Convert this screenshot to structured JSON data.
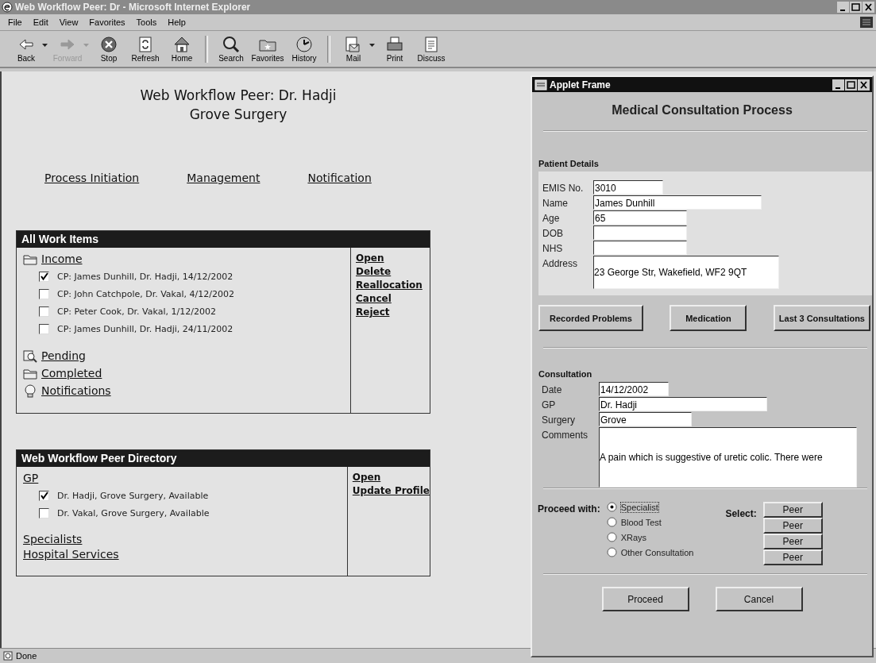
{
  "browser": {
    "title": "Web Workflow Peer: Dr - Microsoft Internet Explorer",
    "menu": [
      "File",
      "Edit",
      "View",
      "Favorites",
      "Tools",
      "Help"
    ],
    "toolbar": [
      {
        "label": "Back",
        "kind": "back",
        "disabled": false,
        "dropdown": true
      },
      {
        "label": "Forward",
        "kind": "forward",
        "disabled": true,
        "dropdown": true
      },
      {
        "label": "Stop",
        "kind": "stop",
        "disabled": false,
        "dropdown": false
      },
      {
        "label": "Refresh",
        "kind": "refresh",
        "disabled": false,
        "dropdown": false
      },
      {
        "label": "Home",
        "kind": "home",
        "disabled": false,
        "dropdown": false
      },
      {
        "label": "Search",
        "kind": "search",
        "disabled": false,
        "dropdown": false
      },
      {
        "label": "Favorites",
        "kind": "favorites",
        "disabled": false,
        "dropdown": false
      },
      {
        "label": "History",
        "kind": "history",
        "disabled": false,
        "dropdown": false
      },
      {
        "label": "Mail",
        "kind": "mail",
        "disabled": false,
        "dropdown": true
      },
      {
        "label": "Print",
        "kind": "print",
        "disabled": false,
        "dropdown": false
      },
      {
        "label": "Discuss",
        "kind": "discuss",
        "disabled": false,
        "dropdown": false
      }
    ],
    "status": "Done"
  },
  "page": {
    "heading": [
      "Web Workflow Peer: Dr. Hadji",
      "Grove Surgery"
    ],
    "nav": [
      "Process Initiation",
      "Management",
      "Notification"
    ],
    "work_items": {
      "title": "All Work Items",
      "folders": [
        {
          "label": "Income",
          "kind": "folder",
          "items": [
            {
              "text": "CP: James Dunhill, Dr. Hadji, 14/12/2002",
              "checked": true
            },
            {
              "text": "CP: John Catchpole, Dr. Vakal, 4/12/2002",
              "checked": false
            },
            {
              "text": "CP: Peter Cook, Dr. Vakal, 1/12/2002",
              "checked": false
            },
            {
              "text": "CP: James Dunhill, Dr. Hadji, 24/11/2002",
              "checked": false
            }
          ]
        },
        {
          "label": "Pending",
          "kind": "magnifier"
        },
        {
          "label": "Completed",
          "kind": "folder"
        },
        {
          "label": "Notifications",
          "kind": "bulb"
        }
      ],
      "actions": [
        "Open",
        "Delete",
        "Reallocation",
        "Cancel",
        "Reject"
      ]
    },
    "directory": {
      "title": "Web Workflow Peer Directory",
      "groups": [
        {
          "label": "GP",
          "items": [
            {
              "text": "Dr. Hadji, Grove Surgery, Available",
              "checked": true
            },
            {
              "text": "Dr. Vakal, Grove Surgery, Available",
              "checked": false
            }
          ]
        },
        {
          "label": "Specialists"
        },
        {
          "label": "Hospital Services"
        }
      ],
      "actions": [
        "Open",
        "Update Profile"
      ]
    }
  },
  "applet": {
    "title": "Applet Frame",
    "heading": "Medical Consultation Process",
    "patient": {
      "title": "Patient Details",
      "fields": [
        {
          "label": "EMIS No.",
          "value": "3010",
          "kind": "line"
        },
        {
          "label": "Name",
          "value": "James Dunhill",
          "kind": "line"
        },
        {
          "label": "Age",
          "value": "65",
          "kind": "line"
        },
        {
          "label": "DOB",
          "kind": "line"
        },
        {
          "label": "NHS",
          "kind": "line"
        },
        {
          "label": "Address",
          "value": "23 George Str, Wakefield, WF2 9QT",
          "kind": "area"
        }
      ]
    },
    "buttons": [
      "Recorded Problems",
      "Medication",
      "Last 3 Consultations"
    ],
    "consultation": {
      "title": "Consultation",
      "fields": [
        {
          "label": "Date",
          "value": "14/12/2002",
          "kind": "line"
        },
        {
          "label": "GP",
          "value": "Dr. Hadji",
          "kind": "line"
        },
        {
          "label": "Surgery",
          "value": "Grove",
          "kind": "line"
        },
        {
          "label": "Comments",
          "value": "A pain which is suggestive of uretic colic. There were",
          "kind": "area"
        }
      ]
    },
    "proceed": {
      "label": "Proceed with:",
      "options": [
        {
          "label": "Specialist",
          "selected": true
        },
        {
          "label": "Blood Test",
          "selected": false
        },
        {
          "label": "XRays",
          "selected": false
        },
        {
          "label": "Other Consultation",
          "selected": false
        }
      ],
      "select_label": "Select:",
      "peer_buttons": [
        "Peer",
        "Peer",
        "Peer",
        "Peer"
      ]
    },
    "actions": [
      "Proceed",
      "Cancel"
    ]
  }
}
